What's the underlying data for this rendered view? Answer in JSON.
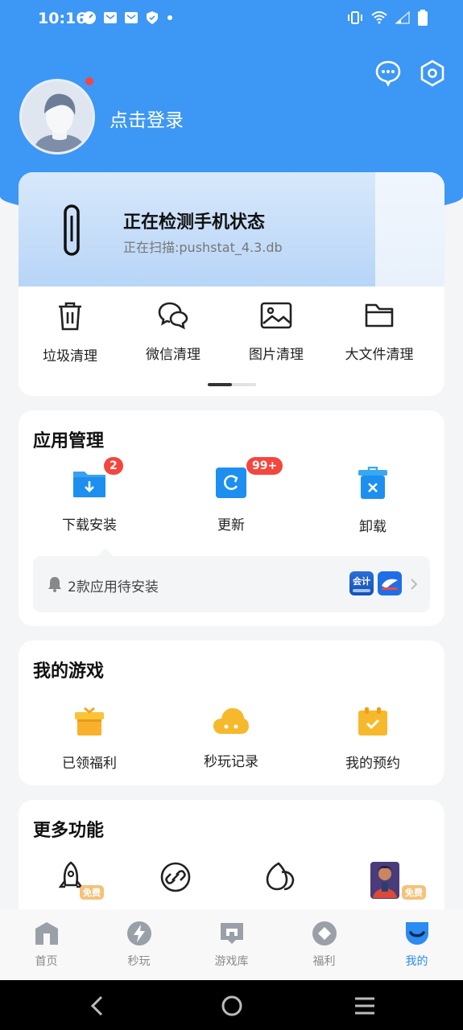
{
  "status": {
    "time": "10:16"
  },
  "profile": {
    "login_text": "点击登录"
  },
  "scan": {
    "title": "正在检测手机状态",
    "subtitle": "正在扫描:pushstat_4.3.db"
  },
  "cleanup": [
    {
      "label": "垃圾清理",
      "icon": "trash-icon"
    },
    {
      "label": "微信清理",
      "icon": "wechat-icon"
    },
    {
      "label": "图片清理",
      "icon": "image-icon"
    },
    {
      "label": "大文件清理",
      "icon": "folder-icon"
    }
  ],
  "app_management": {
    "title": "应用管理",
    "items": [
      {
        "label": "下载安装",
        "badge": "2",
        "icon": "download-folder-icon"
      },
      {
        "label": "更新",
        "badge": "99+",
        "icon": "update-icon"
      },
      {
        "label": "卸载",
        "badge": "",
        "icon": "uninstall-icon"
      }
    ],
    "pending_text": "2款应用待安装",
    "pending_app1": "会计"
  },
  "my_games": {
    "title": "我的游戏",
    "items": [
      {
        "label": "已领福利",
        "icon": "gift-icon"
      },
      {
        "label": "秒玩记录",
        "icon": "cloud-game-icon"
      },
      {
        "label": "我的预约",
        "icon": "calendar-check-icon"
      }
    ]
  },
  "more_features": {
    "title": "更多功能",
    "free_tag": "免费",
    "items": [
      {
        "icon": "rocket-icon"
      },
      {
        "icon": "link-icon"
      },
      {
        "icon": "leaf-icon"
      },
      {
        "icon": "game-character-icon"
      }
    ]
  },
  "tabs": [
    {
      "label": "首页",
      "icon": "home-icon"
    },
    {
      "label": "秒玩",
      "icon": "lightning-icon"
    },
    {
      "label": "游戏库",
      "icon": "game-library-icon"
    },
    {
      "label": "福利",
      "icon": "diamond-icon"
    },
    {
      "label": "我的",
      "icon": "profile-icon",
      "active": true
    }
  ],
  "colors": {
    "primary": "#3d97f4",
    "badge": "#f4463e",
    "active_tab": "#2b8cf1",
    "game_icon": "#f7b92c"
  }
}
